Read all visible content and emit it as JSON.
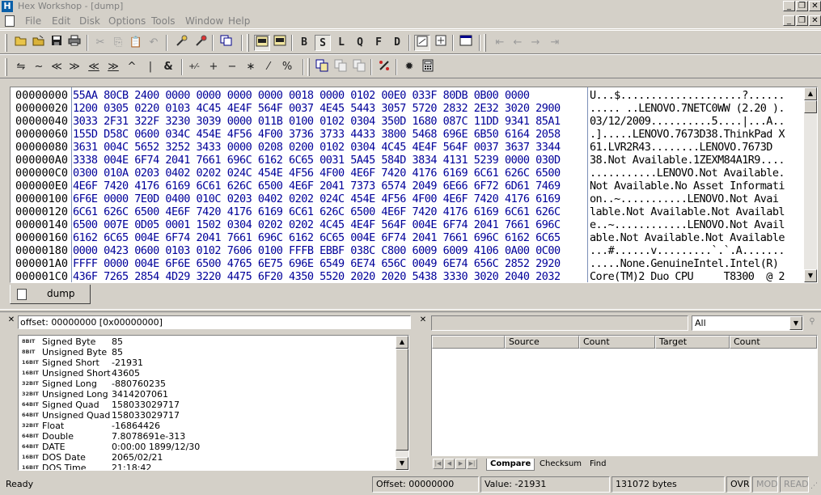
{
  "window": {
    "title": "Hex Workshop - [dump]",
    "app_icon": "H"
  },
  "window_buttons": {
    "minimize": "_",
    "restore": "❐",
    "close": "✕"
  },
  "mdi_buttons": {
    "minimize": "_",
    "restore": "❐",
    "close": "✕"
  },
  "menu": [
    "File",
    "Edit",
    "Disk",
    "Options",
    "Tools",
    "Window",
    "Help"
  ],
  "toolbar2_glyphs": {
    "swap": "⇋",
    "not": "~",
    "shl": "≪",
    "shr": "≫",
    "rol": "≪",
    "ror": "≫",
    "xor": "^",
    "or": "|",
    "and": "&",
    "neg": "+⁄-",
    "add": "+",
    "sub": "−",
    "mul": "∗",
    "div": "⁄",
    "mod": "%"
  },
  "format_buttons": [
    "B",
    "S",
    "L",
    "Q",
    "F",
    "D"
  ],
  "hex": {
    "rows": [
      {
        "offset": "00000000",
        "hex": "55AA 80CB 2400 0000 0000 0000 0000 0018 0000 0102 00E0 033F 80DB 0B00 0000",
        "ascii": "U...$....................?......"
      },
      {
        "offset": "00000020",
        "hex": "1200 0305 0220 0103 4C45 4E4F 564F 0037 4E45 5443 3057 5720 2832 2E32 3020 2900",
        "ascii": "..... ..LENOVO.7NETC0WW (2.20 )."
      },
      {
        "offset": "00000040",
        "hex": "3033 2F31 322F 3230 3039 0000 011B 0100 0102 0304 350D 1680 087C 11DD 9341 85A1",
        "ascii": "03/12/2009..........5....|...A.."
      },
      {
        "offset": "00000060",
        "hex": "155D D58C 0600 034C 454E 4F56 4F00 3736 3733 4433 3800 5468 696E 6B50 6164 2058",
        "ascii": ".].....LENOVO.7673D38.ThinkPad X"
      },
      {
        "offset": "00000080",
        "hex": "3631 004C 5652 3252 3433 0000 0208 0200 0102 0304 4C45 4E4F 564F 0037 3637 3344",
        "ascii": "61.LVR2R43........LENOVO.7673D"
      },
      {
        "offset": "000000A0",
        "hex": "3338 004E 6F74 2041 7661 696C 6162 6C65 0031 5A45 584D 3834 4131 5239 0000 030D",
        "ascii": "38.Not Available.1ZEXM84A1R9...."
      },
      {
        "offset": "000000C0",
        "hex": "0300 010A 0203 0402 0202 024C 454E 4F56 4F00 4E6F 7420 4176 6169 6C61 626C 6500",
        "ascii": "...........LENOVO.Not Available."
      },
      {
        "offset": "000000E0",
        "hex": "4E6F 7420 4176 6169 6C61 626C 6500 4E6F 2041 7373 6574 2049 6E66 6F72 6D61 7469",
        "ascii": "Not Available.No Asset Informati"
      },
      {
        "offset": "00000100",
        "hex": "6F6E 0000 7E0D 0400 010C 0203 0402 0202 024C 454E 4F56 4F00 4E6F 7420 4176 6169",
        "ascii": "on..~...........LENOVO.Not Avai"
      },
      {
        "offset": "00000120",
        "hex": "6C61 626C 6500 4E6F 7420 4176 6169 6C61 626C 6500 4E6F 7420 4176 6169 6C61 626C",
        "ascii": "lable.Not Available.Not Availabl"
      },
      {
        "offset": "00000140",
        "hex": "6500 007E 0D05 0001 1502 0304 0202 0202 4C45 4E4F 564F 004E 6F74 2041 7661 696C",
        "ascii": "e..~............LENOVO.Not Avail"
      },
      {
        "offset": "00000160",
        "hex": "6162 6C65 004E 6F74 2041 7661 696C 6162 6C65 004E 6F74 2041 7661 696C 6162 6C65",
        "ascii": "able.Not Available.Not Available"
      },
      {
        "offset": "00000180",
        "hex": "0000 0423 0600 0103 0102 7606 0100 FFFB EBBF 038C C800 6009 6009 4106 0A00 0C00",
        "ascii": "...#......v.........`.`.A......."
      },
      {
        "offset": "000001A0",
        "hex": "FFFF 0000 004E 6F6E 6500 4765 6E75 696E 6549 6E74 656C 0049 6E74 656C 2852 2920",
        "ascii": ".....None.GenuineIntel.Intel(R) "
      },
      {
        "offset": "000001C0",
        "hex": "436F 7265 2854 4D29 3220 4475 6F20 4350 5520 2020 2020 5438 3330 3020 2040 2032",
        "ascii": "Core(TM)2 Duo CPU     T8300  @ 2"
      }
    ]
  },
  "doc_tab": {
    "label": "dump"
  },
  "offset_field": {
    "text": "offset: 00000000  [0x00000000]"
  },
  "interpreter": [
    {
      "bits": "8BIT",
      "name": "Signed Byte",
      "value": "85"
    },
    {
      "bits": "8BIT",
      "name": "Unsigned Byte",
      "value": "85"
    },
    {
      "bits": "16BIT",
      "name": "Signed Short",
      "value": "-21931"
    },
    {
      "bits": "16BIT",
      "name": "Unsigned Short",
      "value": "43605"
    },
    {
      "bits": "32BIT",
      "name": "Signed Long",
      "value": "-880760235"
    },
    {
      "bits": "32BIT",
      "name": "Unsigned Long",
      "value": "3414207061"
    },
    {
      "bits": "64BIT",
      "name": "Signed Quad",
      "value": "158033029717"
    },
    {
      "bits": "64BIT",
      "name": "Unsigned Quad",
      "value": "158033029717"
    },
    {
      "bits": "32BIT",
      "name": "Float",
      "value": "-16864426"
    },
    {
      "bits": "64BIT",
      "name": "Double",
      "value": "7.8078691e-313"
    },
    {
      "bits": "64BIT",
      "name": "DATE",
      "value": "0:00:00 1899/12/30"
    },
    {
      "bits": "16BIT",
      "name": "DOS Date",
      "value": "2065/02/21"
    },
    {
      "bits": "16BIT",
      "name": "DOS Time",
      "value": "21:18:42"
    }
  ],
  "results": {
    "filter": "All",
    "columns": [
      "Source",
      "Count",
      "Target",
      "Count"
    ],
    "tabs": [
      "Compare",
      "Checksum",
      "Find"
    ]
  },
  "status": {
    "ready": "Ready",
    "offset": "Offset: 00000000",
    "value": "Value: -21931",
    "size": "131072 bytes",
    "ovr": "OVR",
    "mod": "MOD",
    "read": "READ"
  }
}
